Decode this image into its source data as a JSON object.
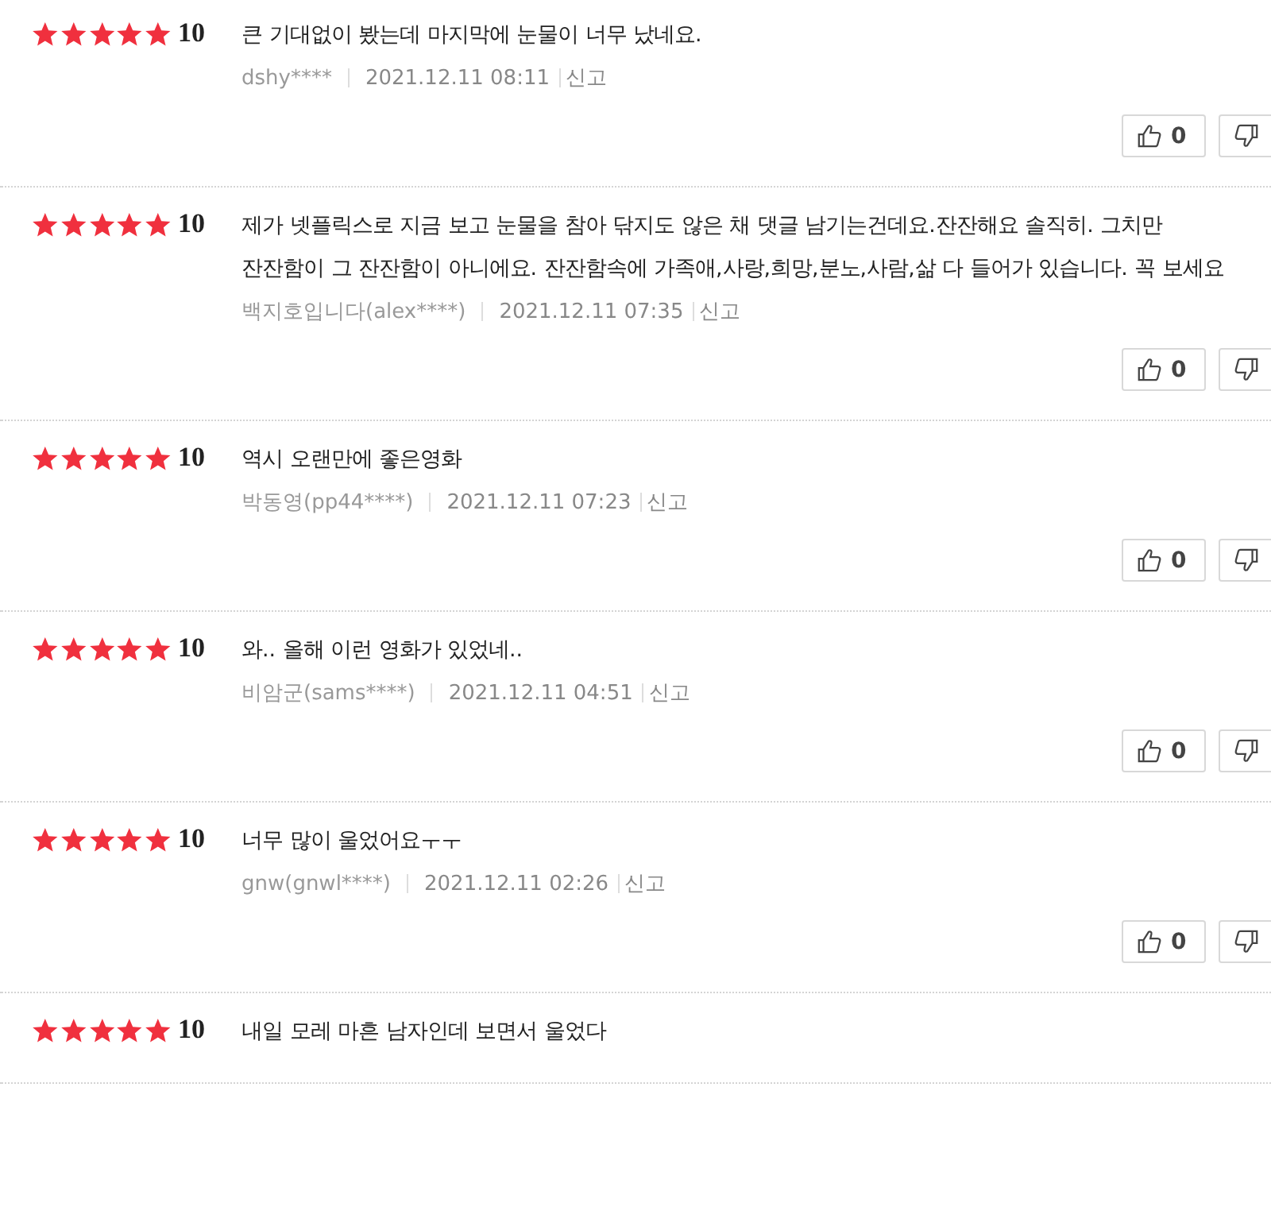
{
  "reviews": [
    {
      "stars": 5,
      "score": "10",
      "text": "큰 기대없이 봤는데 마지막에 눈물이 너무 났네요.",
      "author": "dshy****",
      "date": "2021.12.11 08:11",
      "report": "신고",
      "likes": "0"
    },
    {
      "stars": 5,
      "score": "10",
      "text": "제가 넷플릭스로 지금 보고 눈물을 참아 닦지도 않은 채 댓글 남기는건데요.잔잔해요 솔직히. 그치만 잔잔함이 그 잔잔함이 아니에요. 잔잔함속에 가족애,사랑,희망,분노,사람,삶 다 들어가 있습니다. 꼭 보세요",
      "author": "백지호입니다(alex****)",
      "date": "2021.12.11 07:35",
      "report": "신고",
      "likes": "0"
    },
    {
      "stars": 5,
      "score": "10",
      "text": "역시 오랜만에 좋은영화",
      "author": "박동영(pp44****)",
      "date": "2021.12.11 07:23",
      "report": "신고",
      "likes": "0"
    },
    {
      "stars": 5,
      "score": "10",
      "text": "와.. 올해 이런 영화가 있었네..",
      "author": "비암군(sams****)",
      "date": "2021.12.11 04:51",
      "report": "신고",
      "likes": "0"
    },
    {
      "stars": 5,
      "score": "10",
      "text": "너무 많이 울었어요ㅜㅜ",
      "author": "gnw(gnwl****)",
      "date": "2021.12.11 02:26",
      "report": "신고",
      "likes": "0"
    },
    {
      "stars": 5,
      "score": "10",
      "text": "내일 모레 마흔 남자인데 보면서 울었다"
    }
  ]
}
